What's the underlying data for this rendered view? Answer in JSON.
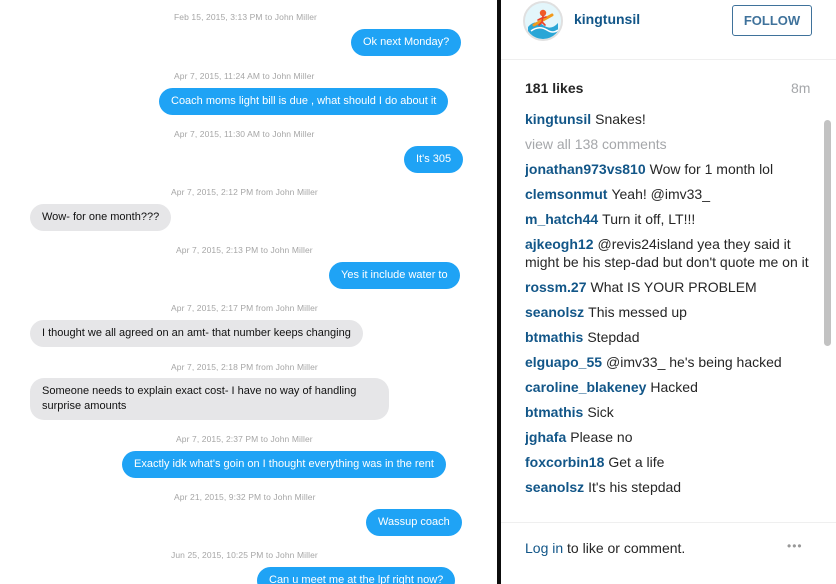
{
  "conversation": [
    {
      "stamp": "Feb 15, 2015, 3:13 PM to John Miller",
      "text": "Ok next Monday?",
      "dir": "out"
    },
    {
      "stamp": "Apr 7, 2015, 11:24 AM to John Miller",
      "text": "Coach moms light bill is due , what should I do about it",
      "dir": "out"
    },
    {
      "stamp": "Apr 7, 2015, 11:30 AM to John Miller",
      "text": "It's 305",
      "dir": "out"
    },
    {
      "stamp": "Apr 7, 2015, 2:12 PM from John Miller",
      "text": "Wow- for one month???",
      "dir": "in"
    },
    {
      "stamp": "Apr 7, 2015, 2:13 PM to John Miller",
      "text": "Yes it include water to",
      "dir": "out"
    },
    {
      "stamp": "Apr 7, 2015, 2:17 PM from John Miller",
      "text": "I thought we all agreed on an amt- that number keeps changing",
      "dir": "in"
    },
    {
      "stamp": "Apr 7, 2015, 2:18 PM from John Miller",
      "text": "Someone needs to explain exact cost- I have no way of handling surprise amounts",
      "dir": "in"
    },
    {
      "stamp": "Apr 7, 2015, 2:37 PM to John Miller",
      "text": "Exactly idk what's goin on I thought everything was in the rent",
      "dir": "out"
    },
    {
      "stamp": "Apr 21, 2015, 9:32 PM to John Miller",
      "text": "Wassup coach",
      "dir": "out"
    },
    {
      "stamp": "Jun 25, 2015, 10:25 PM to John Miller",
      "text": "Can u meet me at the lpf right now?",
      "dir": "out"
    }
  ],
  "post": {
    "username": "kingtunsil",
    "follow_label": "FOLLOW",
    "likes": "181 likes",
    "time": "8m",
    "view_all": "view all 138 comments",
    "comments": [
      {
        "user": "kingtunsil",
        "text": "Snakes!"
      },
      {
        "user": "jonathan973vs810",
        "text": "Wow for 1 month lol"
      },
      {
        "user": "clemsonmut",
        "text": "Yeah! @imv33_"
      },
      {
        "user": "m_hatch44",
        "text": "Turn it off, LT!!!"
      },
      {
        "user": "ajkeogh12",
        "text": "@revis24island yea they said it might be his step-dad but don't quote me on it"
      },
      {
        "user": "rossm.27",
        "text": "What IS YOUR PROBLEM"
      },
      {
        "user": "seanolsz",
        "text": "This messed up"
      },
      {
        "user": "btmathis",
        "text": "Stepdad"
      },
      {
        "user": "elguapo_55",
        "text": "@imv33_ he's being hacked"
      },
      {
        "user": "caroline_blakeney",
        "text": "Hacked"
      },
      {
        "user": "btmathis",
        "text": "Sick"
      },
      {
        "user": "jghafa",
        "text": "Please no"
      },
      {
        "user": "foxcorbin18",
        "text": "Get a life"
      },
      {
        "user": "seanolsz",
        "text": "It's his stepdad"
      }
    ],
    "login_link": "Log in",
    "login_text": "to like or comment.",
    "more_icon": "•••",
    "avatar_icon": "surfer-logo-icon"
  },
  "colors": {
    "outgoing_bubble": "#1fa3f5",
    "incoming_bubble": "#e6e6e8",
    "username": "#125688",
    "follow_border": "#3f729b"
  }
}
